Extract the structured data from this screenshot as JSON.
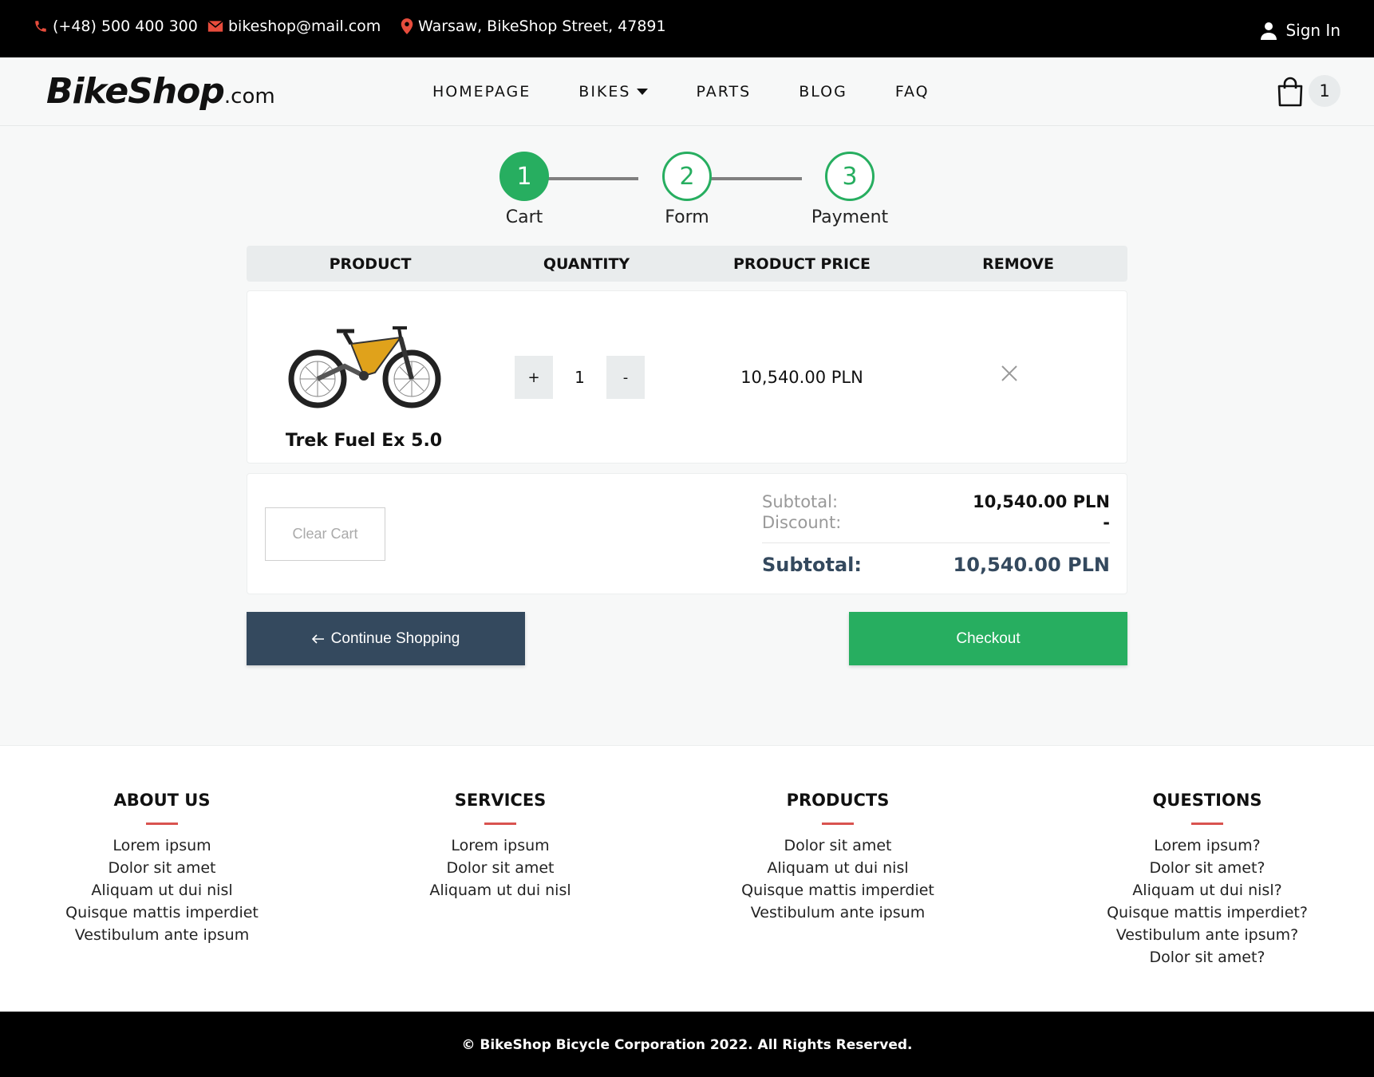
{
  "topbar": {
    "phone": "(+48) 500 400 300",
    "email": "bikeshop@mail.com",
    "address": "Warsaw, BikeShop Street, 47891",
    "sign_in": "Sign In"
  },
  "nav": {
    "logo_main": "BikeShop",
    "logo_suffix": ".com",
    "items": [
      "HOMEPAGE",
      "BIKES",
      "PARTS",
      "BLOG",
      "FAQ"
    ],
    "cart_count": "1"
  },
  "stepper": {
    "steps": [
      {
        "number": "1",
        "label": "Cart"
      },
      {
        "number": "2",
        "label": "Form"
      },
      {
        "number": "3",
        "label": "Payment"
      }
    ]
  },
  "table": {
    "headers": [
      "PRODUCT",
      "QUANTITY",
      "PRODUCT PRICE",
      "REMOVE"
    ],
    "item": {
      "name": "Trek Fuel Ex 5.0",
      "quantity": "1",
      "plus": "+",
      "minus": "-",
      "price": "10,540.00 PLN"
    }
  },
  "summary": {
    "clear_cart": "Clear Cart",
    "subtotal_label": "Subtotal:",
    "subtotal_value": "10,540.00 PLN",
    "discount_label": "Discount:",
    "discount_value": "-",
    "total_label": "Subtotal:",
    "total_value": "10,540.00 PLN"
  },
  "actions": {
    "continue": "Continue Shopping",
    "checkout": "Checkout"
  },
  "footer": {
    "columns": [
      {
        "title": "ABOUT US",
        "links": [
          "Lorem ipsum",
          "Dolor sit amet",
          "Aliquam ut dui nisl",
          "Quisque mattis imperdiet",
          "Vestibulum ante ipsum"
        ]
      },
      {
        "title": "SERVICES",
        "links": [
          "Lorem ipsum",
          "Dolor sit amet",
          "Aliquam ut dui nisl"
        ]
      },
      {
        "title": "PRODUCTS",
        "links": [
          "Dolor sit amet",
          "Aliquam ut dui nisl",
          "Quisque mattis imperdiet",
          "Vestibulum ante ipsum"
        ]
      },
      {
        "title": "QUESTIONS",
        "links": [
          "Lorem ipsum?",
          "Dolor sit amet?",
          "Aliquam ut dui nisl?",
          "Quisque mattis imperdiet?",
          "Vestibulum ante ipsum?",
          "Dolor sit amet?"
        ]
      }
    ],
    "copyright": "© BikeShop Bicycle Corporation 2022. All Rights Reserved."
  },
  "colors": {
    "accent_green": "#27ae60",
    "dark_blue": "#34495e",
    "footer_bar_red": "#d9534f",
    "icon_red": "#e74c3c"
  },
  "icons": [
    "phone-icon",
    "mail-icon",
    "location-pin-icon",
    "user-icon",
    "shopping-bag-icon",
    "close-icon",
    "arrow-left-icon",
    "chevron-down-icon"
  ]
}
